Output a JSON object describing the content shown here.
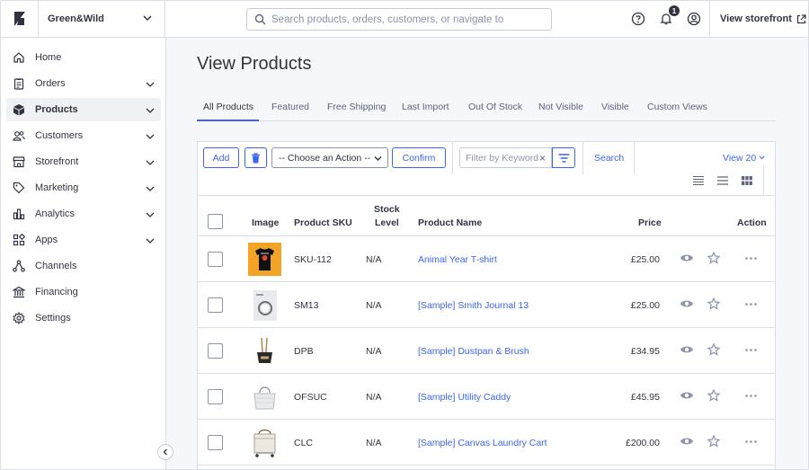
{
  "header": {
    "store_name": "Green&Wild",
    "search_placeholder": "Search products, orders, customers, or navigate to",
    "notifications_count": "1",
    "view_storefront": "View storefront"
  },
  "sidebar": {
    "items": [
      {
        "label": "Home",
        "icon": "home-icon",
        "expandable": false
      },
      {
        "label": "Orders",
        "icon": "orders-icon",
        "expandable": true
      },
      {
        "label": "Products",
        "icon": "products-icon",
        "expandable": true,
        "active": true
      },
      {
        "label": "Customers",
        "icon": "customers-icon",
        "expandable": true
      },
      {
        "label": "Storefront",
        "icon": "storefront-icon",
        "expandable": true
      },
      {
        "label": "Marketing",
        "icon": "tag-icon",
        "expandable": true
      },
      {
        "label": "Analytics",
        "icon": "analytics-icon",
        "expandable": true
      },
      {
        "label": "Apps",
        "icon": "apps-icon",
        "expandable": true
      },
      {
        "label": "Channels",
        "icon": "channels-icon",
        "expandable": false
      },
      {
        "label": "Financing",
        "icon": "bank-icon",
        "expandable": false
      },
      {
        "label": "Settings",
        "icon": "gear-icon",
        "expandable": false
      }
    ]
  },
  "main": {
    "title": "View Products",
    "tabs": [
      {
        "label": "All Products",
        "active": true
      },
      {
        "label": "Featured"
      },
      {
        "label": "Free Shipping"
      },
      {
        "label": "Last Import"
      },
      {
        "label": "Out Of Stock"
      },
      {
        "label": "Not Visible"
      },
      {
        "label": "Visible"
      },
      {
        "label": "Custom Views"
      }
    ],
    "toolbar": {
      "add_label": "Add",
      "action_select_value": "-- Choose an Action --",
      "confirm_label": "Confirm",
      "filter_placeholder": "Filter by Keyword",
      "search_label": "Search",
      "view_count_label": "View 20"
    },
    "table": {
      "columns": {
        "image": "Image",
        "sku": "Product SKU",
        "stock_line1": "Stock",
        "stock_line2": "Level",
        "name": "Product Name",
        "price": "Price",
        "action": "Action"
      },
      "rows": [
        {
          "sku": "SKU-112",
          "stock": "N/A",
          "name": "Animal Year T-shirt",
          "price": "£25.00",
          "thumb": "tshirt"
        },
        {
          "sku": "SM13",
          "stock": "N/A",
          "name": "[Sample] Smith Journal 13",
          "price": "£25.00",
          "thumb": "journal"
        },
        {
          "sku": "DPB",
          "stock": "N/A",
          "name": "[Sample] Dustpan & Brush",
          "price": "£34.95",
          "thumb": "dustpan"
        },
        {
          "sku": "OFSUC",
          "stock": "N/A",
          "name": "[Sample] Utility Caddy",
          "price": "£45.95",
          "thumb": "caddy"
        },
        {
          "sku": "CLC",
          "stock": "N/A",
          "name": "[Sample] Canvas Laundry Cart",
          "price": "£200.00",
          "thumb": "cart"
        }
      ]
    }
  },
  "colors": {
    "accent": "#3c64f4",
    "text": "#313440",
    "border": "#d9dce9",
    "background": "#f5f7fa"
  }
}
